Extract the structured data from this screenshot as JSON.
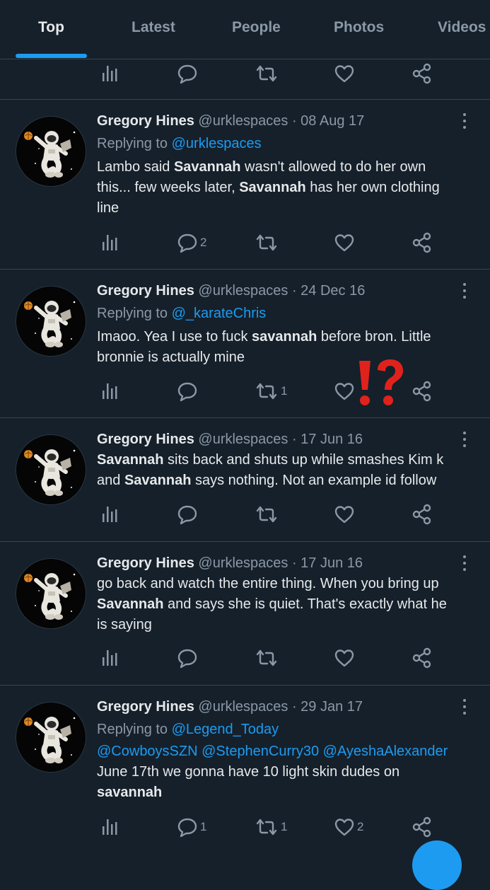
{
  "tabs": [
    "Top",
    "Latest",
    "People",
    "Photos",
    "Videos"
  ],
  "colors": {
    "background": "#15202b",
    "accent": "#1d9bf0",
    "muted": "#8b98a5",
    "text": "#e7e9ea",
    "divider": "#38444d",
    "emoji": "#e0221c"
  },
  "icons": [
    "analytics-icon",
    "reply-icon",
    "retweet-icon",
    "like-icon",
    "share-icon",
    "more-icon",
    "exclamation-question-icon"
  ],
  "tweets": [
    {
      "name": "Gregory Hines",
      "meta": "@urklespaces · 08 Aug 17",
      "replying_prefix": "Replying to ",
      "replying_to": "@urklespaces",
      "text_parts": [
        "Lambo said ",
        "Savannah",
        " wasn't allowed to do her own",
        "this... few weeks later, ",
        "Savannah",
        " has her own clothing",
        "line"
      ],
      "replies": "2",
      "retweets": "",
      "likes": ""
    },
    {
      "name": "Gregory Hines",
      "meta": "@urklespaces · 24 Dec 16",
      "replying_prefix": "Replying to ",
      "replying_to": "@_karateChris",
      "text_parts": [
        "Imaoo. Yea I use to fuck ",
        "savannah",
        " before bron. Little",
        "bronnie is actually mine"
      ],
      "replies": "",
      "retweets": "1",
      "likes": ""
    },
    {
      "name": "Gregory Hines",
      "meta": "@urklespaces · 17 Jun 16",
      "text_parts": [
        "Savannah",
        " sits back and shuts up while smashes Kim k",
        "and ",
        "Savannah",
        " says nothing. Not an example id follow"
      ],
      "replies": "",
      "retweets": "",
      "likes": ""
    },
    {
      "name": "Gregory Hines",
      "meta": "@urklespaces · 17 Jun 16",
      "text_parts": [
        "go back and watch the entire thing. When you bring up",
        "Savannah",
        " and says she is quiet. That's exactly what he",
        "is saying"
      ],
      "replies": "",
      "retweets": "",
      "likes": ""
    },
    {
      "name": "Gregory Hines",
      "meta": "@urklespaces · 29 Jan 17",
      "replying_prefix": "Replying to ",
      "replying_to": "@Legend_Today",
      "text_parts": [
        "@CowboysSZN @StephenCurry30 @AyeshaAlexander",
        "June 17th we gonna have 10 light skin dudes on",
        "savannah"
      ],
      "replies": "1",
      "retweets": "1",
      "likes": "2"
    }
  ]
}
